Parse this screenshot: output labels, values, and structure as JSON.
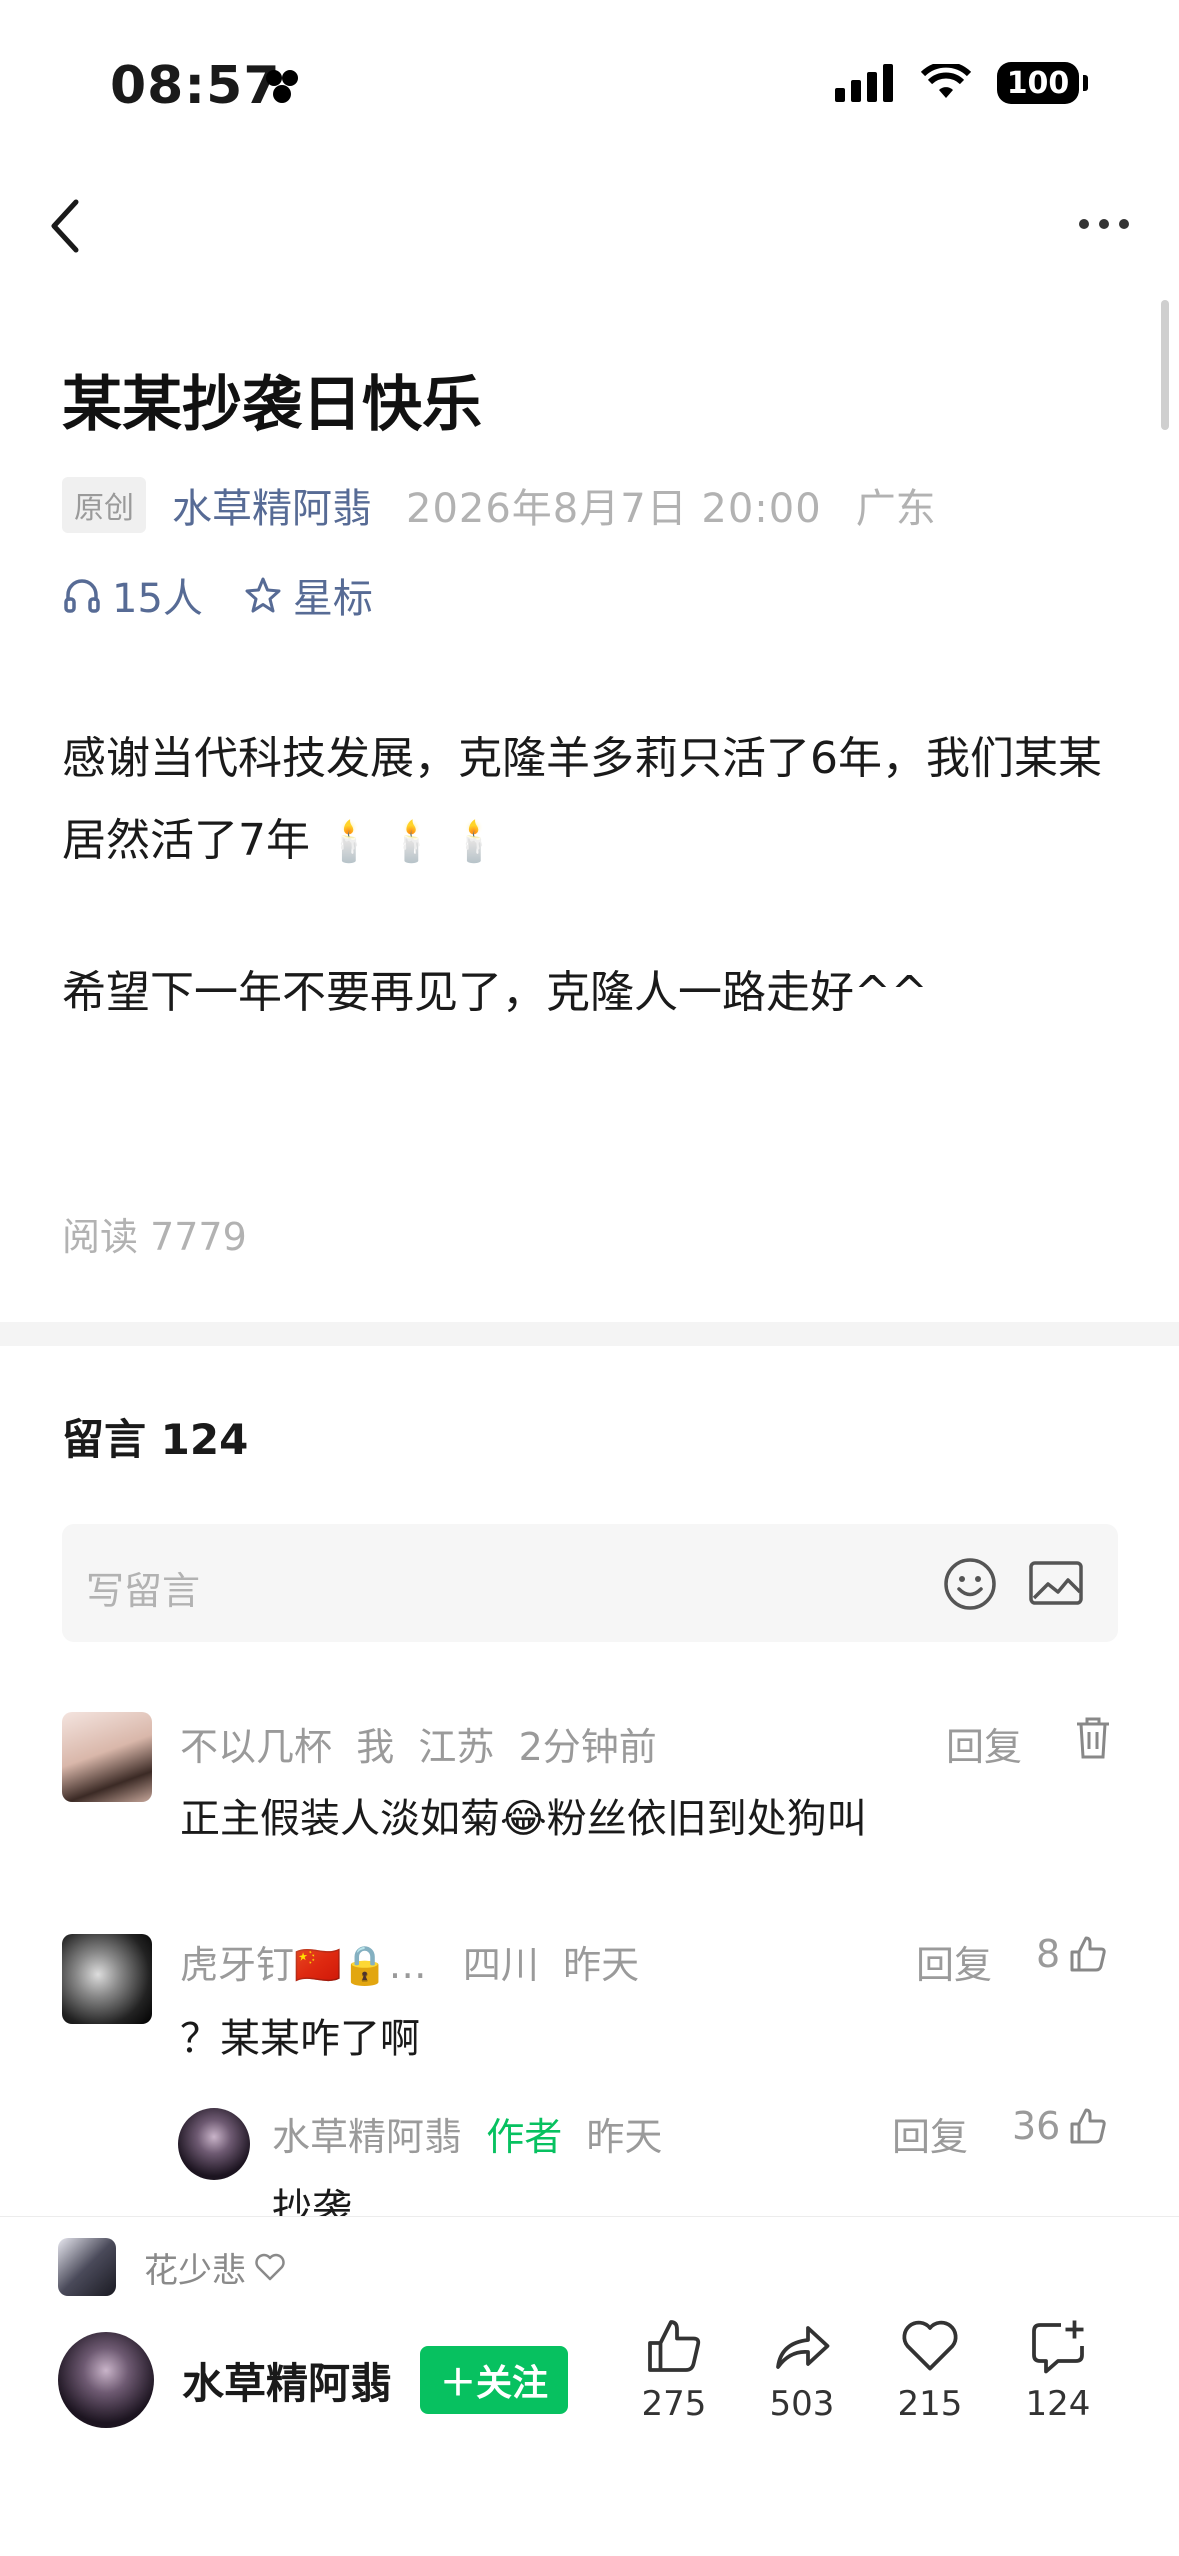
{
  "status_bar": {
    "time": "08:57",
    "battery": "100"
  },
  "article": {
    "title": "某某抄袭日快乐",
    "tag": "原创",
    "author": "水草精阿翡",
    "date": "2026年8月7日 20:00",
    "region": "广东",
    "listeners": "15人",
    "star_label": "星标",
    "paragraph1": "感谢当代科技发展，克隆羊多莉只活了6年，我们某某居然活了7年",
    "candles": "🕯️ 🕯️ 🕯️",
    "paragraph2": "希望下一年不要再见了，克隆人一路走好^^",
    "read_count": "阅读 7779"
  },
  "comments_section": {
    "header": "留言 124",
    "input_placeholder": "写留言",
    "comments": [
      {
        "name": "不以几杯",
        "tag": "我",
        "region": "江苏",
        "time": "2分钟前",
        "text": "正主假装人淡如菊😂粉丝依旧到处狗叫",
        "reply": "回复"
      },
      {
        "name": "虎牙钉🇨🇳🔒…",
        "region": "四川",
        "time": "昨天",
        "text": "？某某咋了啊",
        "reply": "回复",
        "likes": "8"
      },
      {
        "name": "水草精阿翡",
        "badge": "作者",
        "time": "昨天",
        "text": "抄袭",
        "reply": "回复",
        "likes": "36"
      }
    ]
  },
  "bottom_bar": {
    "liker_name": "花少悲",
    "author_name": "水草精阿翡",
    "follow_label": "＋关注",
    "like_count": "275",
    "share_count": "503",
    "fav_count": "215",
    "comment_count": "124"
  },
  "colors": {
    "link": "#576b95",
    "green": "#07c160",
    "gray": "#b2b2b2"
  }
}
